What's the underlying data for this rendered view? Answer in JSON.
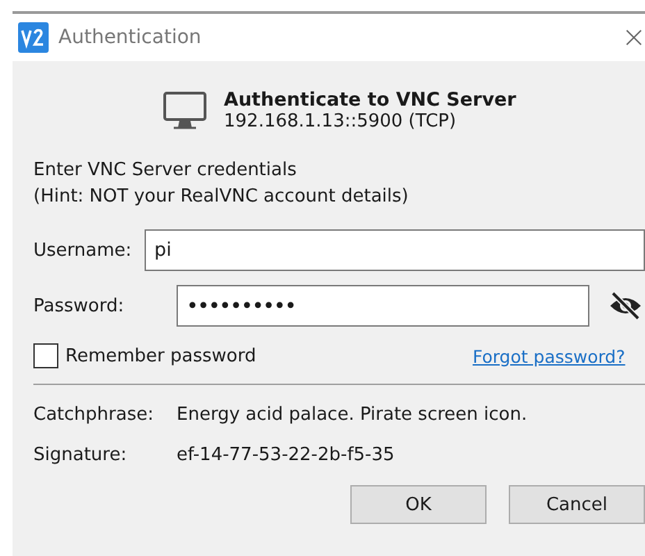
{
  "window": {
    "title": "Authentication"
  },
  "header": {
    "title": "Authenticate to VNC Server",
    "address": "192.168.1.13::5900 (TCP)"
  },
  "intro": [
    "Enter VNC Server credentials",
    "(Hint: NOT your RealVNC account details)"
  ],
  "fields": [
    {
      "label": "Username:",
      "value": "pi",
      "kind": "text"
    },
    {
      "label": "Password:",
      "value": "••••••••••",
      "kind": "password"
    }
  ],
  "remember": {
    "label": "Remember password",
    "checked": false
  },
  "forgot_link": "Forgot password?",
  "info": [
    {
      "label": "Catchphrase:",
      "value": "Energy acid palace. Pirate screen icon."
    },
    {
      "label": "Signature:",
      "value": "ef-14-77-53-22-2b-f5-35"
    }
  ],
  "buttons": [
    "OK",
    "Cancel"
  ]
}
